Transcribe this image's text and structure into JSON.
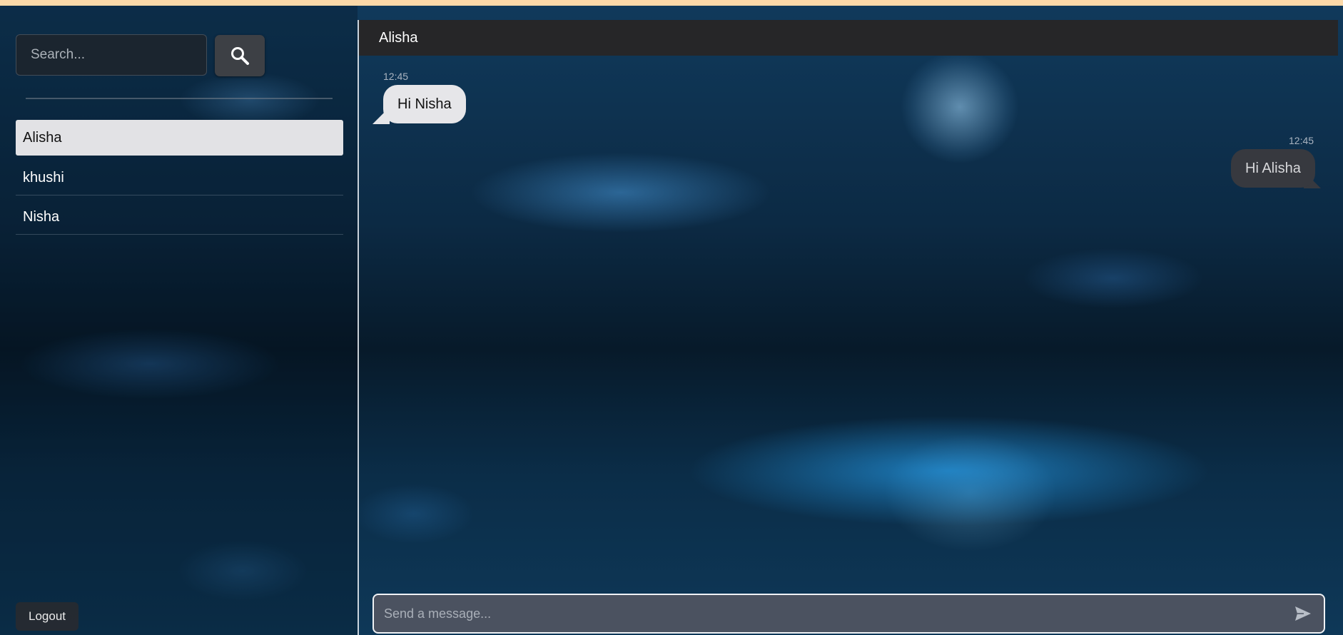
{
  "sidebar": {
    "search": {
      "placeholder": "Search...",
      "value": ""
    },
    "search_button_icon": "search-icon",
    "contacts": [
      {
        "name": "Alisha",
        "active": true
      },
      {
        "name": "khushi",
        "active": false
      },
      {
        "name": "Nisha",
        "active": false
      }
    ],
    "logout_label": "Logout"
  },
  "chat": {
    "title": "Alisha",
    "messages": [
      {
        "direction": "incoming",
        "time": "12:45",
        "text": "Hi Nisha"
      },
      {
        "direction": "outgoing",
        "time": "12:45",
        "text": "Hi Alisha"
      }
    ],
    "composer": {
      "placeholder": "Send a message...",
      "value": "",
      "send_icon": "send-icon"
    }
  },
  "colors": {
    "top_strip": "#fcd9a9",
    "header_bg": "#262628",
    "active_contact_bg": "#e2e2e5",
    "incoming_bubble": "#e6e6e9",
    "outgoing_bubble": "#37393f",
    "composer_bg": "#4b5260"
  }
}
